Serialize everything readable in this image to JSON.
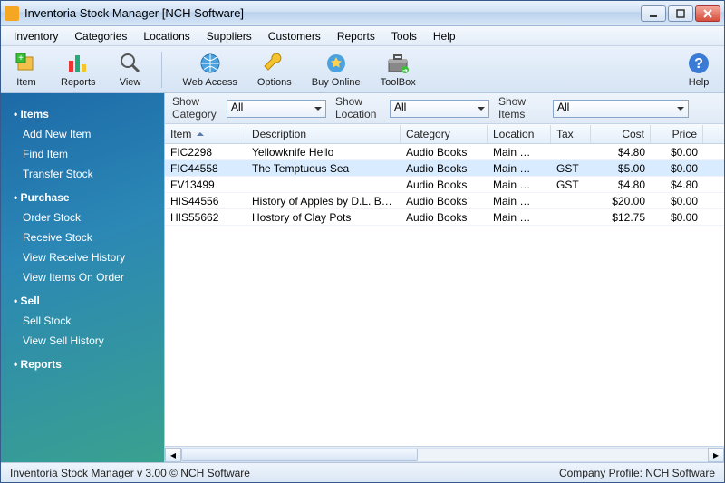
{
  "window": {
    "title": "Inventoria Stock Manager [NCH Software]"
  },
  "menu": [
    "Inventory",
    "Categories",
    "Locations",
    "Suppliers",
    "Customers",
    "Reports",
    "Tools",
    "Help"
  ],
  "toolbar": {
    "item": "Item",
    "reports": "Reports",
    "view": "View",
    "webaccess": "Web Access",
    "options": "Options",
    "buyonline": "Buy Online",
    "toolbox": "ToolBox",
    "help": "Help"
  },
  "filters": {
    "category_label": "Show\nCategory",
    "category_value": "All",
    "location_label": "Show\nLocation",
    "location_value": "All",
    "items_label": "Show\nItems",
    "items_value": "All"
  },
  "sidebar": {
    "groups": [
      {
        "header": "Items",
        "items": [
          "Add New Item",
          "Find Item",
          "Transfer Stock"
        ]
      },
      {
        "header": "Purchase",
        "items": [
          "Order Stock",
          "Receive Stock",
          "View Receive History",
          "View Items On Order"
        ]
      },
      {
        "header": "Sell",
        "items": [
          "Sell Stock",
          "View Sell History"
        ]
      },
      {
        "header": "Reports",
        "items": []
      }
    ]
  },
  "columns": [
    "Item",
    "Description",
    "Category",
    "Location",
    "Tax",
    "Cost",
    "Price"
  ],
  "rows": [
    {
      "item": "FIC2298",
      "desc": "Yellowknife Hello",
      "cat": "Audio Books",
      "loc": "Main …",
      "tax": "",
      "cost": "$4.80",
      "price": "$0.00",
      "selected": false
    },
    {
      "item": "FIC44558",
      "desc": "The Temptuous Sea",
      "cat": "Audio Books",
      "loc": "Main …",
      "tax": "GST",
      "cost": "$5.00",
      "price": "$0.00",
      "selected": true
    },
    {
      "item": "FV13499",
      "desc": "",
      "cat": "Audio Books",
      "loc": "Main …",
      "tax": "GST",
      "cost": "$4.80",
      "price": "$4.80",
      "selected": false
    },
    {
      "item": "HIS44556",
      "desc": "History of Apples by D.L. Brewer",
      "cat": "Audio Books",
      "loc": "Main …",
      "tax": "",
      "cost": "$20.00",
      "price": "$0.00",
      "selected": false
    },
    {
      "item": "HIS55662",
      "desc": "Hostory of Clay Pots",
      "cat": "Audio Books",
      "loc": "Main …",
      "tax": "",
      "cost": "$12.75",
      "price": "$0.00",
      "selected": false
    }
  ],
  "status": {
    "left": "Inventoria Stock Manager v 3.00 © NCH Software",
    "right": "Company Profile: NCH Software"
  }
}
